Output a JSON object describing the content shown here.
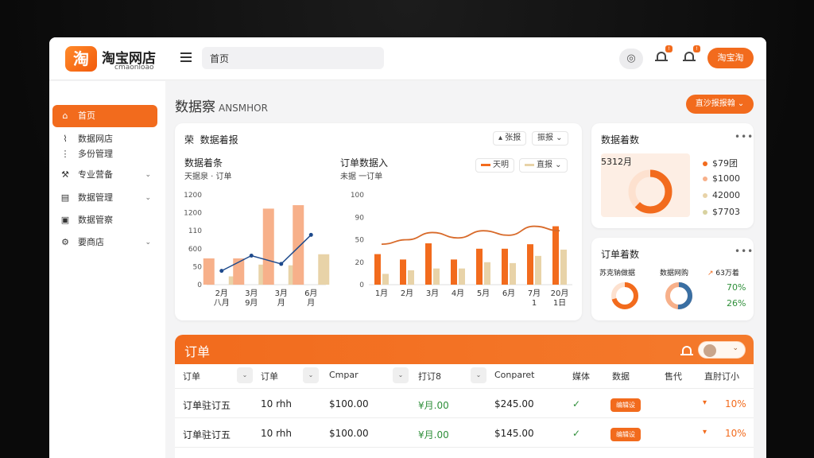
{
  "header": {
    "logo_glyph": "淘",
    "app_name": "淘宝网店",
    "app_sub": "cmaonloao",
    "search_value": "首页",
    "notif_badges": [
      "!",
      "!"
    ],
    "login_label": "淘宝淘"
  },
  "sidebar": {
    "items": [
      {
        "label": "首页",
        "icon": "home-icon",
        "active": true
      },
      {
        "label": "数据网店",
        "icon": "chart-icon"
      },
      {
        "label": "多份管理",
        "icon": "list-icon"
      },
      {
        "label": "专业营备",
        "icon": "tools-icon",
        "expandable": true
      },
      {
        "label": "数据管理",
        "icon": "database-icon",
        "expandable": true
      },
      {
        "label": "数据管察",
        "icon": "monitor-icon"
      },
      {
        "label": "要商店",
        "icon": "store-icon",
        "expandable": true
      }
    ]
  },
  "main": {
    "title": "数据察",
    "title_suffix": "ANSMHOR",
    "top_dropdown": "直沙报报翰"
  },
  "sales_card": {
    "title": "数据着报",
    "title_prefix": "荣",
    "pill_a": "张报",
    "pill_b": "振报",
    "left_title": "数据着条",
    "left_sub": "天据泉 · 订单",
    "right_title": "订单数据入",
    "right_sub": "未据 一订单",
    "legend_a": "天明",
    "legend_b": "直报"
  },
  "chart_data": [
    {
      "type": "bar",
      "title": "数据着条",
      "categories": [
        "2月\n八月",
        "3月\n9月",
        "3月\n月",
        "6月\n月"
      ],
      "yticks": [
        "0",
        "50",
        "600",
        "110",
        "1200",
        "1200"
      ],
      "series": [
        {
          "values": [
            380,
            380,
            1100,
            1150
          ],
          "color": "#f7b08a"
        },
        {
          "values": [
            0,
            0,
            0,
            0
          ],
          "color": "#f26b1d"
        },
        {
          "values": [
            120,
            290,
            280,
            440
          ],
          "color": "#e8d3a8"
        }
      ],
      "line": {
        "values": [
          200,
          420,
          300,
          720
        ],
        "color": "#1e4a8c"
      },
      "ylim": [
        0,
        1300
      ]
    },
    {
      "type": "bar",
      "title": "订单数据入",
      "categories": [
        "1月",
        "2月",
        "3月",
        "4月",
        "5月",
        "6月",
        "7月\n1",
        "20月\n1日"
      ],
      "yticks": [
        "0",
        "20",
        "50",
        "90",
        "100"
      ],
      "series": [
        {
          "values": [
            34,
            28,
            46,
            28,
            40,
            40,
            45,
            65
          ],
          "color": "#f26b1d"
        },
        {
          "values": [
            12,
            16,
            18,
            18,
            25,
            24,
            32,
            39
          ],
          "color": "#e8d3a8"
        }
      ],
      "line": {
        "values": [
          45,
          50,
          58,
          52,
          60,
          55,
          65,
          60
        ],
        "color": "#d86a2a"
      },
      "ylim": [
        0,
        100
      ]
    }
  ],
  "stats_card": {
    "title": "数据着数",
    "period": "5312月",
    "legend": [
      {
        "value": "$79团",
        "color": "#f26b1d"
      },
      {
        "value": "$1000",
        "color": "#f7b08a"
      },
      {
        "value": "42000",
        "color": "#e8d3a8"
      },
      {
        "value": "$7703",
        "color": "#d8d2a0"
      }
    ]
  },
  "orders_stat_card": {
    "title": "订单着数",
    "col_a": "苏克钠做据",
    "col_b": "数据网购",
    "col_c_prefix": "↗",
    "col_c": "63万着",
    "pct_a": "70%",
    "pct_b": "26%"
  },
  "orders": {
    "title": "订单",
    "columns": [
      "订单",
      "订单",
      "Cmpar",
      "打订8",
      "Conparet",
      "媒体",
      "数据",
      "售代",
      "直肘订小"
    ],
    "rows": [
      {
        "name": "订单驻订五",
        "qty": "10 rhh",
        "price": "$100.00",
        "rate": "¥月.00",
        "total": "$245.00",
        "tag": "编辑设",
        "pct": "10%"
      },
      {
        "name": "订单驻订五",
        "qty": "10 rhh",
        "price": "$100.00",
        "rate": "¥月.00",
        "total": "$145.00",
        "tag": "编辑设",
        "pct": "10%"
      }
    ]
  }
}
